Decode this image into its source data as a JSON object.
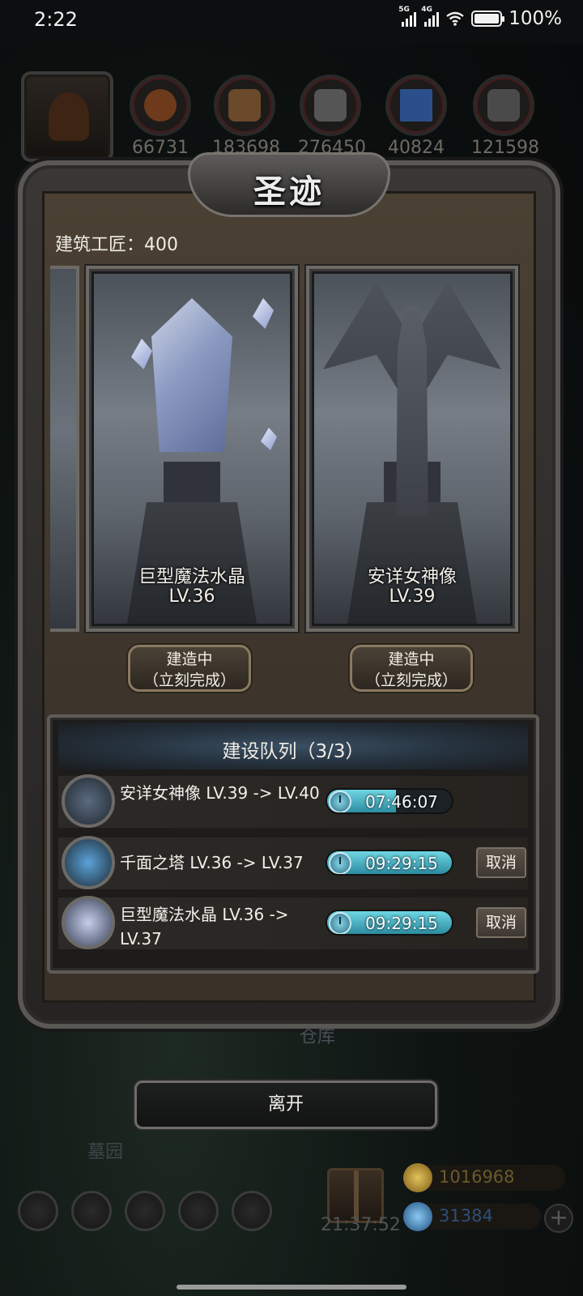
{
  "status_bar": {
    "time": "2:22",
    "net1": "5G",
    "net2": "4G",
    "battery": "100%"
  },
  "resources": [
    {
      "icon": "meat-icon",
      "value": "66731",
      "color": "#6e3a1c"
    },
    {
      "icon": "wood-icon",
      "value": "183698",
      "color": "#6a4a2a"
    },
    {
      "icon": "stone-icon",
      "value": "276450",
      "color": "#555555"
    },
    {
      "icon": "crystal-icon",
      "value": "40824",
      "color": "#2b4f8a"
    },
    {
      "icon": "iron-icon",
      "value": "121598",
      "color": "#4a4a4a"
    }
  ],
  "modal": {
    "title": "圣迹",
    "craftsman_label": "建筑工匠：400",
    "cards": [
      {
        "name": "巨型魔法水晶",
        "level": "LV.36",
        "button_line1": "建造中",
        "button_line2": "（立刻完成）"
      },
      {
        "name": "安详女神像",
        "level": "LV.39",
        "button_line1": "建造中",
        "button_line2": "（立刻完成）"
      }
    ],
    "queue": {
      "title": "建设队列（3/3）",
      "rows": [
        {
          "text": "安详女神像 LV.39 -> LV.40",
          "timer": "07:46:07",
          "progress": 0.55,
          "cancel": ""
        },
        {
          "text": "千面之塔 LV.36 -> LV.37",
          "timer": "09:29:15",
          "progress": 1.0,
          "cancel": "取消"
        },
        {
          "text": "巨型魔法水晶 LV.36 -> LV.37",
          "timer": "09:29:15",
          "progress": 1.0,
          "cancel": "取消"
        }
      ]
    }
  },
  "background": {
    "faded_label_1": "仓库",
    "faded_label_2": "墓园"
  },
  "leave_button": "离开",
  "hud": {
    "gift_timer": "21:37:52",
    "gold": "1016968",
    "gems": "31384",
    "plus": "+"
  },
  "colors": {
    "gold": "#c9a83a",
    "gem": "#4a86c8",
    "timer_fill": "#4fb8c8"
  }
}
